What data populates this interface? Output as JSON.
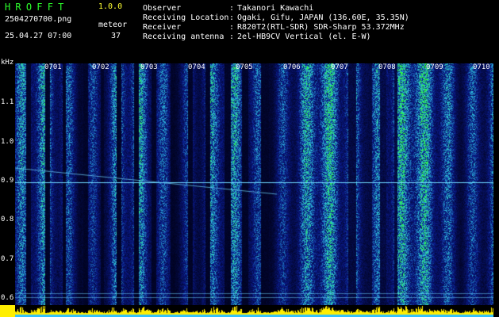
{
  "header": {
    "app_title": "HROFFT",
    "app_version": "1.0.0",
    "file_name": "2504270700.png",
    "datetime": "25.04.27 07:00",
    "count_label": "meteor",
    "count_value": "37"
  },
  "info": [
    {
      "label": "Observer",
      "value": "Takanori Kawachi"
    },
    {
      "label": "Receiving Location",
      "value": "Ogaki, Gifu, JAPAN (136.60E, 35.35N)"
    },
    {
      "label": "Receiver",
      "value": "R820T2(RTL-SDR) SDR-Sharp 53.372MHz"
    },
    {
      "label": "Receiving antenna",
      "value": "2el-HB9CV Vertical (el. E-W)"
    }
  ],
  "axis": {
    "unit": "kHz",
    "y_ticks": [
      "1.1",
      "1.0",
      "0.9",
      "0.8",
      "0.7",
      "0.6"
    ],
    "x_ticks": [
      "0701",
      "0702",
      "0703",
      "0704",
      "0705",
      "0706",
      "0707",
      "0708",
      "0709",
      "0710"
    ]
  },
  "colors": {
    "background": "#000000",
    "noise_low": "#0a1a8c",
    "noise_mid": "#2fbfe0",
    "noise_high": "#2cff2c",
    "carrier": "#6fd8ff",
    "activity_bar": "#ffee00",
    "text_green": "#2cff2c",
    "text_yellow": "#ffff33"
  }
}
